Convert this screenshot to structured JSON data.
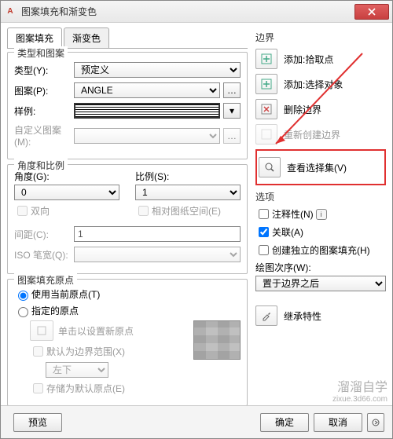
{
  "title": "图案填充和渐变色",
  "tabs": {
    "hatch": "图案填充",
    "gradient": "渐变色"
  },
  "type_pattern": {
    "group": "类型和图案",
    "type_label": "类型(Y):",
    "type_value": "预定义",
    "pattern_label": "图案(P):",
    "pattern_value": "ANGLE",
    "sample_label": "样例:",
    "custom_label": "自定义图案(M):"
  },
  "angle_scale": {
    "group": "角度和比例",
    "angle_label": "角度(G):",
    "angle_value": "0",
    "scale_label": "比例(S):",
    "scale_value": "1",
    "two_way": "双向",
    "paper_space": "相对图纸空间(E)",
    "spacing_label": "间距(C):",
    "spacing_value": "1",
    "iso_label": "ISO 笔宽(Q):"
  },
  "origin": {
    "group": "图案填充原点",
    "use_current": "使用当前原点(T)",
    "specified": "指定的原点",
    "click_set": "单击以设置新原点",
    "default_bound": "默认为边界范围(X)",
    "position": "左下",
    "store_default": "存储为默认原点(E)"
  },
  "boundary": {
    "header": "边界",
    "add_pick": "添加:拾取点",
    "add_select": "添加:选择对象",
    "remove": "删除边界",
    "recreate": "重新创建边界",
    "view_selection": "查看选择集(V)"
  },
  "options": {
    "header": "选项",
    "annotative": "注释性(N)",
    "associative": "关联(A)",
    "independent": "创建独立的图案填充(H)",
    "draw_order_label": "绘图次序(W):",
    "draw_order_value": "置于边界之后",
    "inherit": "继承特性"
  },
  "footer": {
    "preview": "预览",
    "ok": "确定",
    "cancel": "取消"
  },
  "watermark": {
    "line1": "溜溜自学",
    "line2": "zixue.3d66.com"
  }
}
